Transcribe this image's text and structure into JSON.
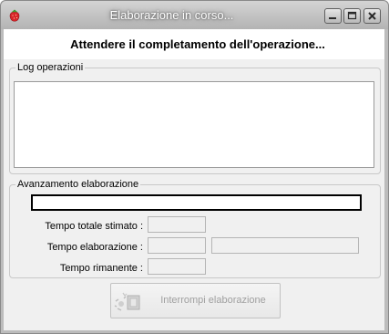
{
  "window": {
    "title": "Elaborazione in corso...",
    "app_icon": "strawberry-icon",
    "controls": [
      "minimize-icon",
      "maximize-icon",
      "close-icon"
    ]
  },
  "header": {
    "message": "Attendere il completamento dell'operazione..."
  },
  "log": {
    "legend": "Log operazioni",
    "content": ""
  },
  "progress": {
    "legend": "Avanzamento elaborazione",
    "fraction": 0,
    "fields": {
      "total_label": "Tempo totale stimato :",
      "total_value": "",
      "elapsed_label": "Tempo elaborazione :",
      "elapsed_value": "",
      "elapsed_extra": "",
      "remaining_label": "Tempo rimanente :",
      "remaining_value": ""
    }
  },
  "actions": {
    "stop_label": "Interrompi elaborazione",
    "stop_icon": "interrupt-icon",
    "stop_enabled": false
  },
  "colors": {
    "titlebar": "#bcbcbc",
    "client": "#f0f0f0",
    "disabled_text": "#a0a0a0",
    "progress_fill": "#3c8fd8"
  }
}
